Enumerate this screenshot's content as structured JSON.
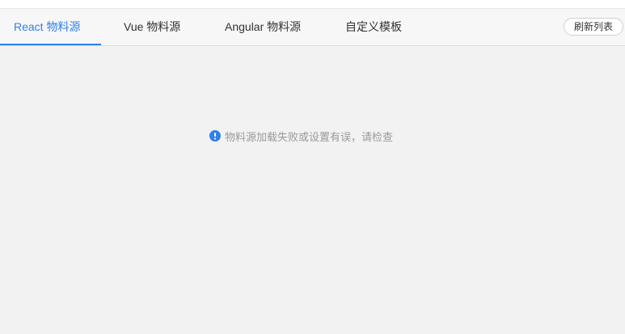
{
  "tabs": [
    {
      "label": "React 物料源",
      "active": true
    },
    {
      "label": "Vue 物料源",
      "active": false
    },
    {
      "label": "Angular 物料源",
      "active": false
    },
    {
      "label": "自定义模板",
      "active": false
    }
  ],
  "toolbar": {
    "refresh_label": "刷新列表"
  },
  "main": {
    "error_icon": "info-circle-icon",
    "error_message": "物料源加载失败或设置有误，请检查"
  },
  "colors": {
    "accent": "#2f80ed",
    "background": "#f2f2f2",
    "muted_text": "#9a9a9a"
  }
}
